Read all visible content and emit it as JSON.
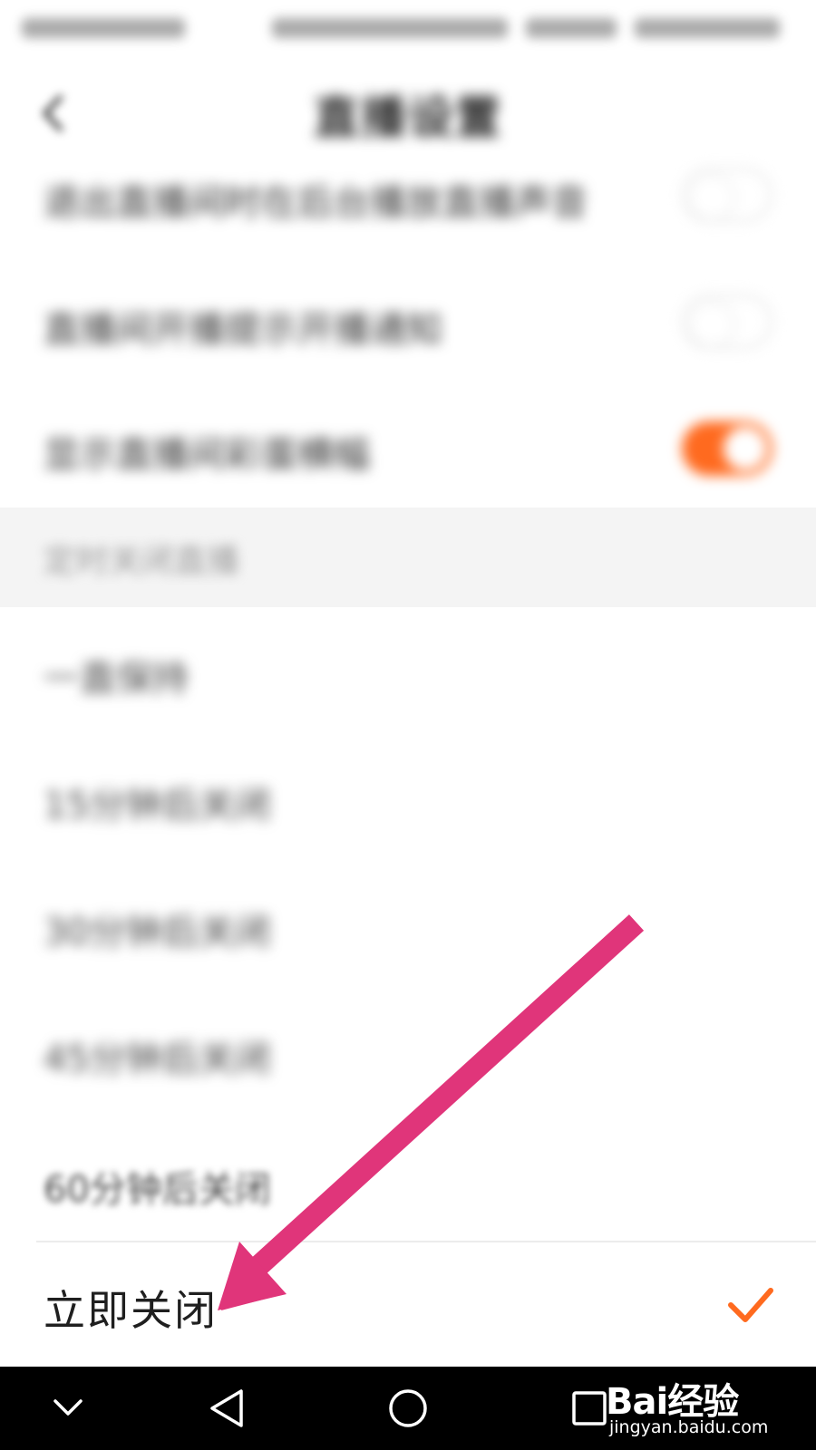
{
  "header": {
    "title": "直播设置"
  },
  "toggles": [
    {
      "label": "退出直播间时在后台播放直播声音",
      "state": "off"
    },
    {
      "label": "直播间开播提示开播通知",
      "state": "off"
    },
    {
      "label": "显示直播间彩蛋横幅",
      "state": "on"
    }
  ],
  "section": {
    "label": "定时关闭直播"
  },
  "timer_options": [
    {
      "label": "一直保持"
    },
    {
      "label": "15分钟后关闭"
    },
    {
      "label": "30分钟后关闭"
    },
    {
      "label": "45分钟后关闭"
    },
    {
      "label": "60分钟后关闭"
    }
  ],
  "selected_option": {
    "label": "立即关闭",
    "selected": true
  },
  "colors": {
    "accent": "#ff6a1f",
    "annotation_arrow": "#e0357a",
    "nav_bar": "#000000"
  },
  "watermark": {
    "logo": "Bai经验",
    "url": "jingyan.baidu.com"
  },
  "icons": [
    "back-icon",
    "check-icon",
    "nav-collapse-icon",
    "nav-back-icon",
    "nav-home-icon",
    "nav-recents-icon"
  ]
}
